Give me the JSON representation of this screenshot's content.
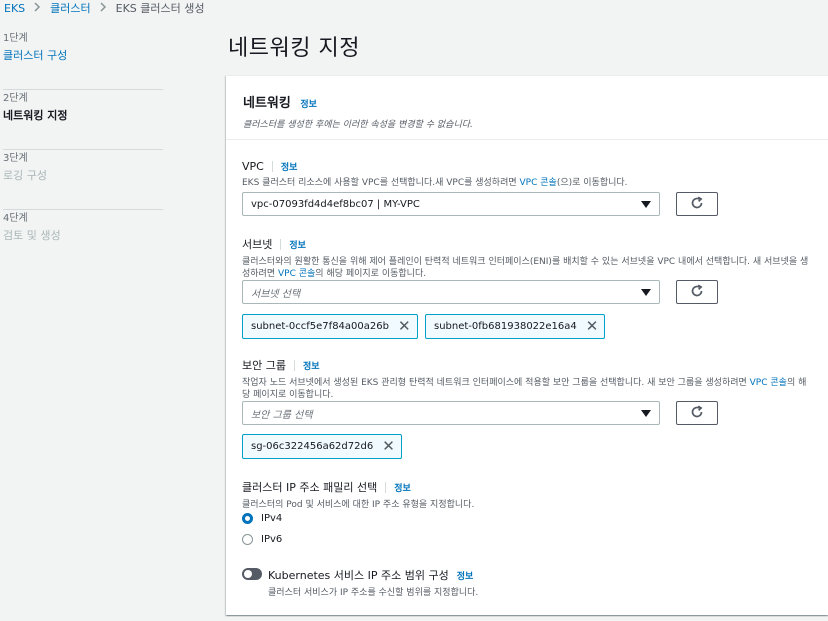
{
  "breadcrumb": {
    "items": [
      "EKS",
      "클러스터",
      "EKS 클러스터 생성"
    ]
  },
  "steps": [
    {
      "num": "1단계",
      "label": "클러스터 구성",
      "state": "link"
    },
    {
      "num": "2단계",
      "label": "네트워킹 지정",
      "state": "current"
    },
    {
      "num": "3단계",
      "label": "로깅 구성",
      "state": "disabled"
    },
    {
      "num": "4단계",
      "label": "검토 및 생성",
      "state": "disabled"
    }
  ],
  "page": {
    "title": "네트워킹 지정"
  },
  "panel": {
    "title": "네트워킹",
    "info": "정보",
    "desc": "클러스터를 생성한 후에는 이러한 속성을 변경할 수 없습니다."
  },
  "vpc": {
    "label": "VPC",
    "info": "정보",
    "desc_before": "EKS 클러스터 리소스에 사용할 VPC를 선택합니다.새 VPC를 생성하려면 ",
    "desc_link": "VPC 콘솔",
    "desc_after": "(으)로 이동합니다.",
    "value": "vpc-07093fd4d4ef8bc07 | MY-VPC"
  },
  "subnet": {
    "label": "서브넷",
    "info": "정보",
    "desc_before": "클러스터와의 원활한 통신을 위해 제어 플레인이 탄력적 네트워크 인터페이스(ENI)를 배치할 수 있는 서브넷을 VPC 내에서 선택합니다. 새 서브넷을 생성하려면 ",
    "desc_link": "VPC 콘솔",
    "desc_after": "의 해당 페이지로 이동합니다.",
    "placeholder": "서브넷 선택",
    "tokens": [
      "subnet-0ccf5e7f84a00a26b",
      "subnet-0fb681938022e16a4"
    ]
  },
  "security_group": {
    "label": "보안 그룹",
    "info": "정보",
    "desc_before": "작업자 노드 서브넷에서 생성된 EKS 관리형 탄력적 네트워크 인터페이스에 적용할 보안 그룹을 선택합니다. 새 보안 그룹을 생성하려면 ",
    "desc_link": "VPC 콘솔",
    "desc_after": "의 해당 페이지로 이동합니다.",
    "placeholder": "보안 그룹 선택",
    "tokens": [
      "sg-06c322456a62d72d6"
    ]
  },
  "ip_family": {
    "label": "클러스터 IP 주소 패밀리 선택",
    "info": "정보",
    "desc": "클러스터의 Pod 및 서비스에 대한 IP 주소 유형을 지정합니다.",
    "options": [
      "IPv4",
      "IPv6"
    ],
    "selected": "IPv4"
  },
  "k8s_ip_range": {
    "label": "Kubernetes 서비스 IP 주소 범위 구성",
    "info": "정보",
    "desc": "클러스터 서비스가 IP 주소를 수신할 범위를 지정합니다.",
    "enabled": false
  },
  "colors": {
    "accent": "#0073bb",
    "token_border": "#00a1c9"
  },
  "icons": {
    "refresh": "refresh-icon",
    "remove": "close-icon",
    "dropdown": "caret-down-icon",
    "breadcrumb_sep": "chevron-right-icon"
  }
}
